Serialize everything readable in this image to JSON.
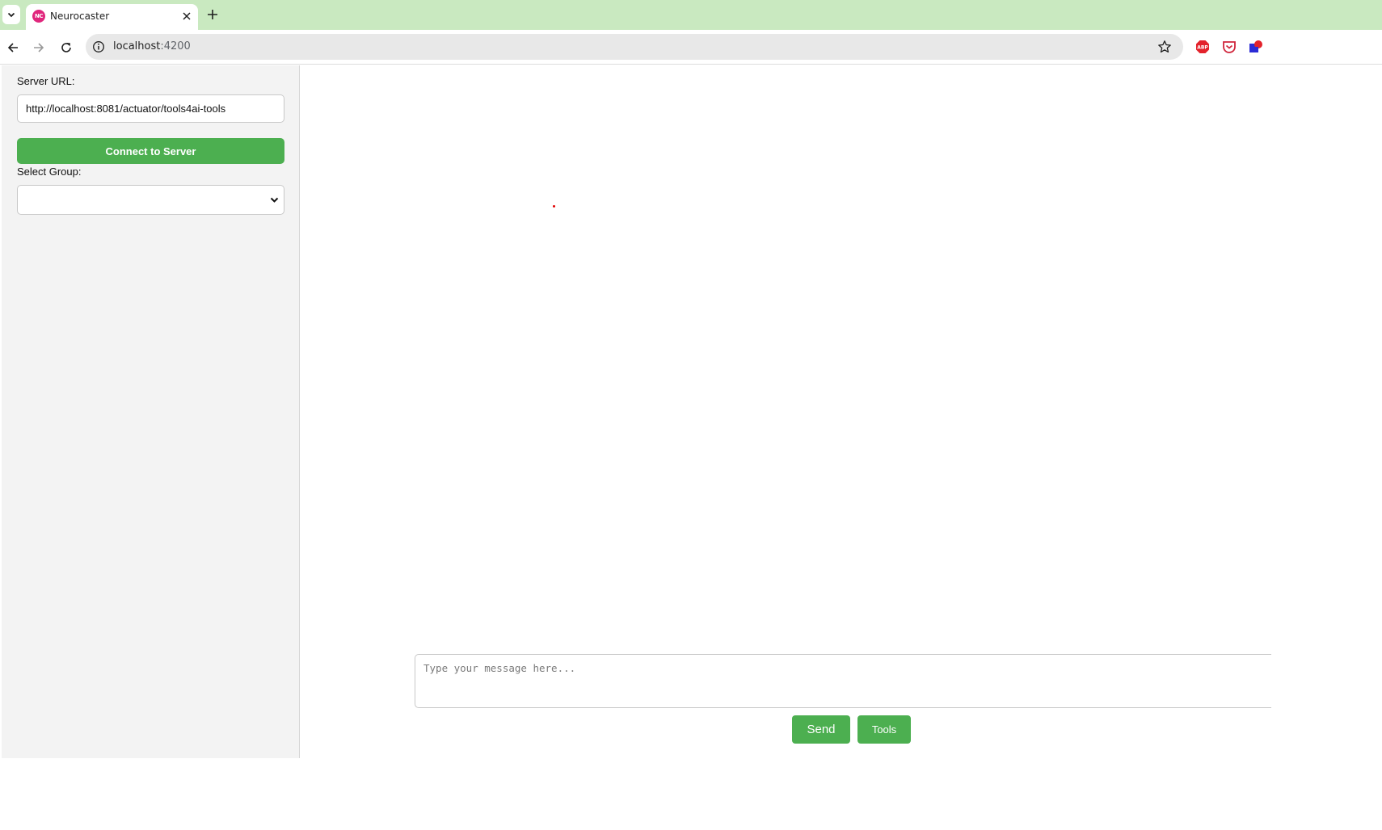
{
  "browser": {
    "tab": {
      "title": "Neurocaster",
      "favicon_text": "NC"
    },
    "address": {
      "host": "localhost",
      "port": ":4200"
    },
    "extensions": [
      "adblock-plus-icon",
      "pocket-icon",
      "extension-icon"
    ]
  },
  "sidebar": {
    "server_url_label": "Server URL:",
    "server_url_value": "http://localhost:8081/actuator/tools4ai-tools",
    "connect_label": "Connect to Server",
    "group_label": "Select Group:",
    "group_value": ""
  },
  "chat": {
    "input_placeholder": "Type your message here...",
    "send_label": "Send",
    "tools_label": "Tools"
  },
  "colors": {
    "accent": "#4caf50",
    "tabstrip": "#c9e9c0",
    "favicon": "#e0267c"
  }
}
